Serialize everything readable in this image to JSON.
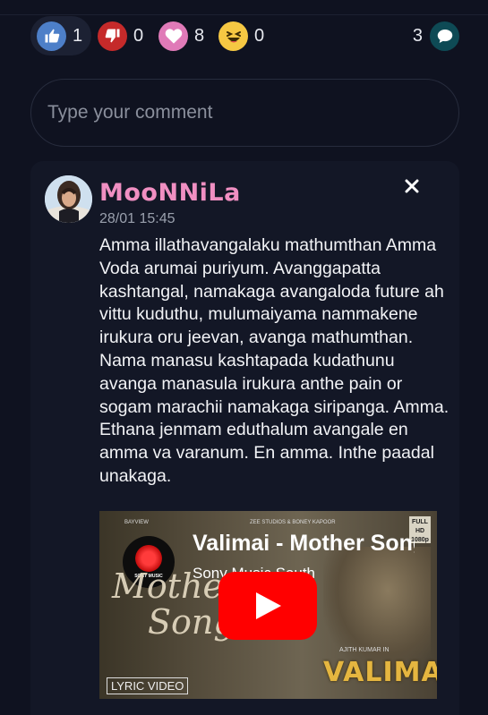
{
  "reactions": {
    "like": {
      "count": "1",
      "color": "#4d7fc8"
    },
    "dislike": {
      "count": "0",
      "color": "#c52a2a"
    },
    "love": {
      "count": "8",
      "color": "#e07ab8"
    },
    "laugh": {
      "count": "0",
      "color": "#f6c843"
    },
    "comments": {
      "count": "3",
      "color": "#0e4a55"
    }
  },
  "comment_input": {
    "placeholder": "Type your comment"
  },
  "comment": {
    "username": "MooNNiLa",
    "timestamp": "28/01 15:45",
    "text": "Amma illathavangalaku mathumthan Amma Voda arumai puriyum. Avanggapatta kashtangal, namakaga avangaloda future ah vittu kuduthu, mulumaiyama nammakene irukura oru jeevan, avanga mathumthan. Nama manasu kashtapada kudathunu avanga manasula irukura anthe pain or sogam marachii namakaga siripanga. Amma. Ethana jenmam eduthalum avangale en amma va varanum. En amma. Inthe paadal unakaga."
  },
  "video": {
    "title": "Valimai - Mother Song",
    "channel": "Sony Music South",
    "badge": "LYRIC VIDEO",
    "logo_text": "VALIMAI",
    "script_line1": "Mother",
    "script_line2": "Song",
    "sony_label": "SONY MUSIC",
    "hd_label": "FULL HD 1080p",
    "credits_top": "ZEE STUDIOS & BONEY KAPOOR",
    "credits_actor": "AJITH KUMAR IN",
    "bayview": "BAYVIEW"
  }
}
